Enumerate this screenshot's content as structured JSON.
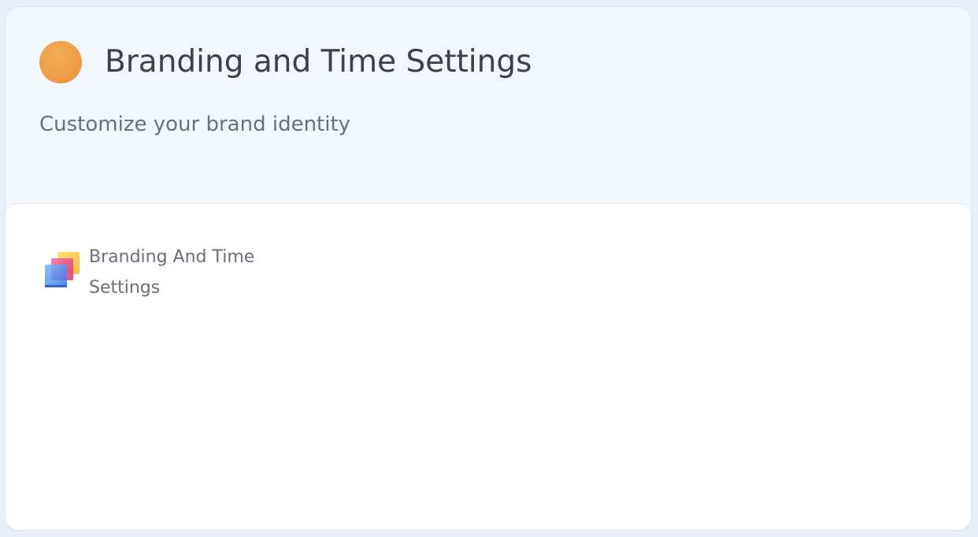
{
  "header": {
    "icon": "orange-circle-icon",
    "icon_color": "#EE9D45",
    "title": "Branding and Time Settings",
    "subtitle": "Customize your brand identity"
  },
  "content": {
    "items": [
      {
        "icon": "stacked-squares-icon",
        "label": "Branding And Time Settings"
      }
    ]
  }
}
